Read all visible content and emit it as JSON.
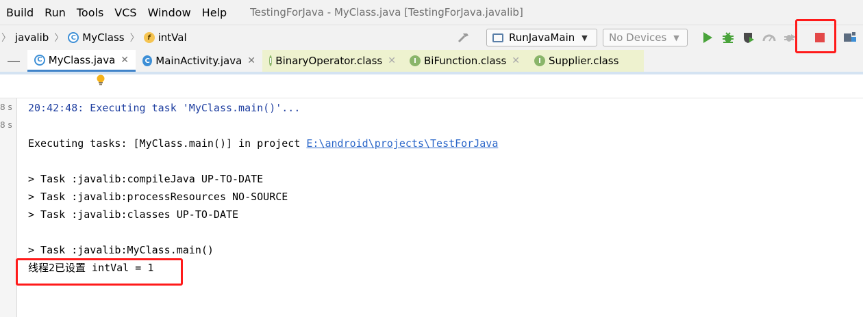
{
  "menu": {
    "items": [
      "Build",
      "Run",
      "Tools",
      "VCS",
      "Window",
      "Help"
    ],
    "title": "TestingForJava - MyClass.java [TestingForJava.javalib]"
  },
  "navbar": {
    "breadcrumbs": [
      {
        "label": "javalib",
        "icon": "folder-arrow"
      },
      {
        "label": "MyClass",
        "icon": "class-icon"
      },
      {
        "label": "intVal",
        "icon": "field-icon"
      }
    ]
  },
  "toolbar": {
    "run_config": "RunJavaMain",
    "device": "No Devices",
    "icons": [
      "hammer-icon",
      "run-icon",
      "debug-icon",
      "coverage-icon",
      "profile-icon",
      "apply-changes-icon",
      "stop-icon",
      "project-structure-icon"
    ]
  },
  "tabs": [
    {
      "label": "MyClass.java",
      "active": true,
      "kind": "java-run"
    },
    {
      "label": "MainActivity.java",
      "active": false,
      "kind": "java"
    },
    {
      "label": "BinaryOperator.class",
      "active": false,
      "kind": "interface"
    },
    {
      "label": "BiFunction.class",
      "active": false,
      "kind": "interface"
    },
    {
      "label": "Supplier.class",
      "active": false,
      "kind": "interface"
    }
  ],
  "gutter": {
    "times": [
      "8 s",
      "8 s"
    ]
  },
  "console": {
    "line1": "20:42:48: Executing task 'MyClass.main()'...",
    "line2": "",
    "line3_prefix": "Executing tasks: [MyClass.main()] in project ",
    "line3_link": "E:\\android\\projects\\TestForJava",
    "line4": "",
    "line5": "> Task :javalib:compileJava UP-TO-DATE",
    "line6": "> Task :javalib:processResources NO-SOURCE",
    "line7": "> Task :javalib:classes UP-TO-DATE",
    "line8": "",
    "line9": "> Task :javalib:MyClass.main()",
    "line10": "线程2已设置 intVal = 1"
  },
  "colors": {
    "highlight": "#ff1a1a",
    "link": "#2a66c9",
    "accent": "#4083c9"
  }
}
